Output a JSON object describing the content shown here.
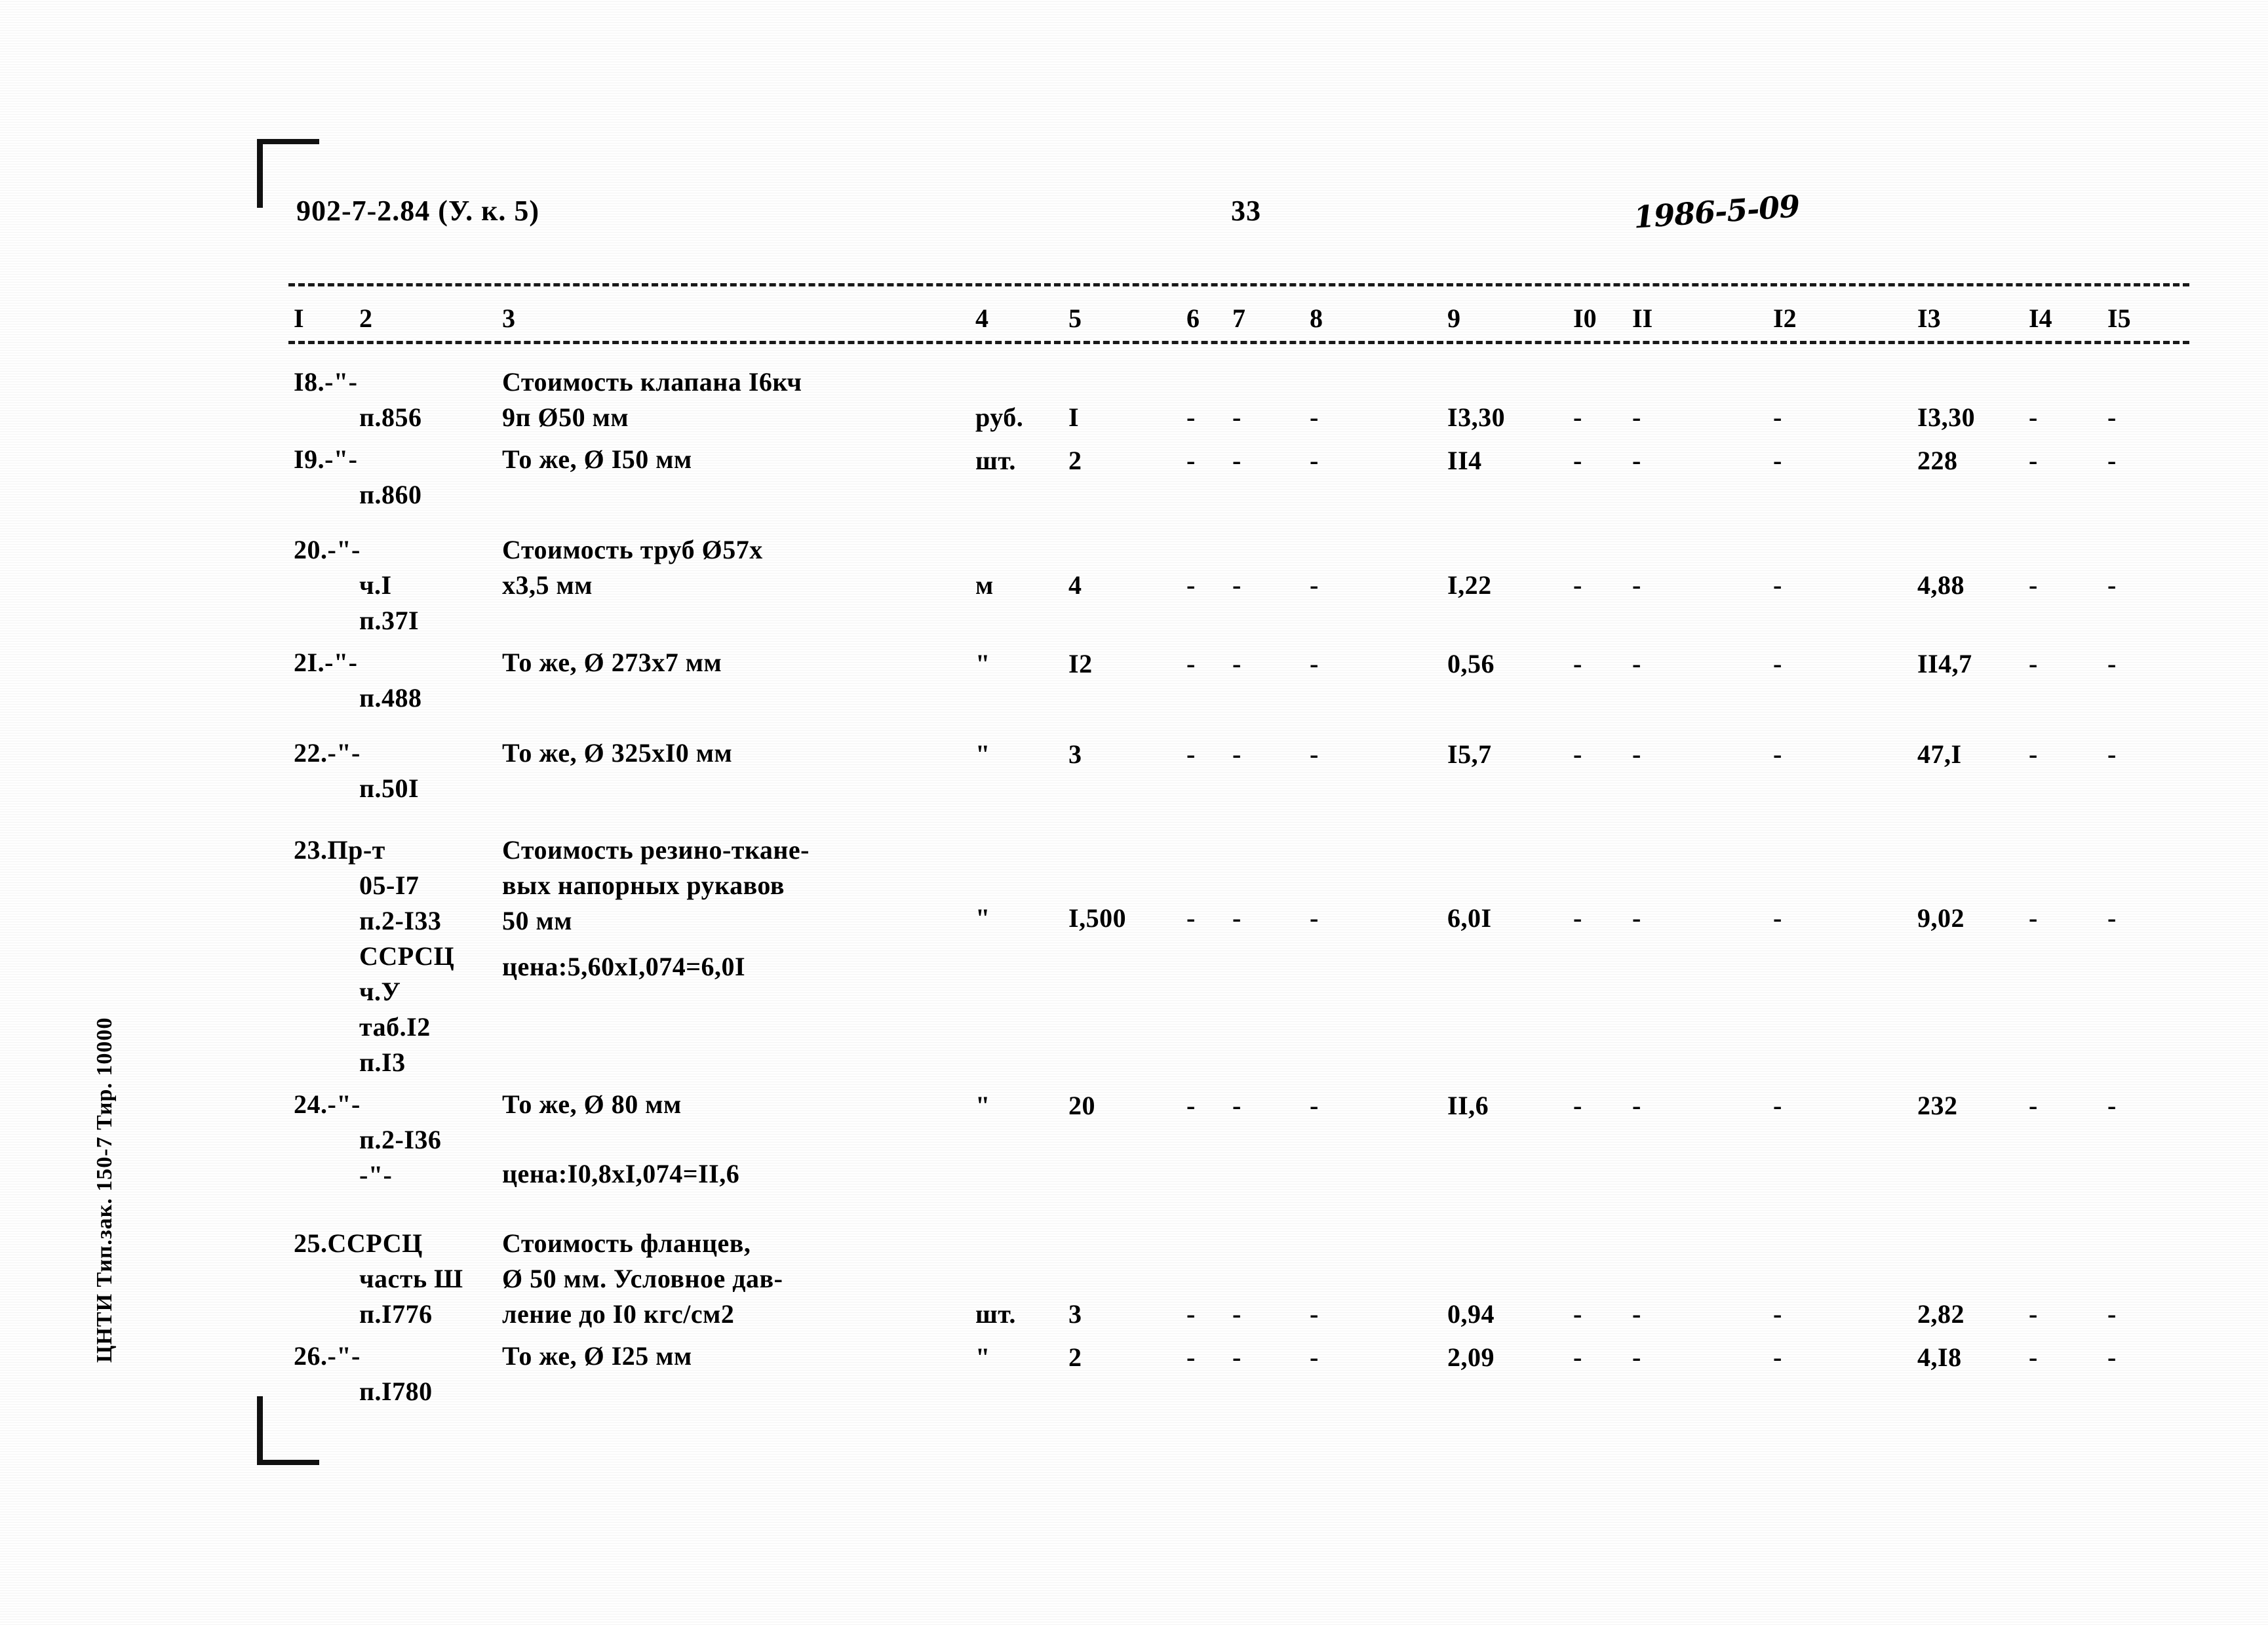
{
  "header": {
    "doc_code": "902-7-2.84 (У. к. 5)",
    "page_number": "33",
    "handwritten_note": "1986-5-09"
  },
  "imprint": {
    "sidebar_text": "ЦНТИ Тип.зак. 150-7 Тир. 10000"
  },
  "table": {
    "column_headers": [
      "I",
      "2",
      "3",
      "4",
      "5",
      "6",
      "7",
      "8",
      "9",
      "I0",
      "II",
      "I2",
      "I3",
      "I4",
      "I5"
    ],
    "dash": "-",
    "rows": [
      {
        "c1": "I8.-\"-",
        "c2": "п.856",
        "c3": "Стоимость клапана I6кч\n9п Ø50 мм",
        "c4": "руб.",
        "c5": "I",
        "c6": "-",
        "c7": "-",
        "c8": "-",
        "c9": "I3,30",
        "c10": "-",
        "c11": "-",
        "c12": "-",
        "c13": "I3,30",
        "c14": "-",
        "c15": "-"
      },
      {
        "c1": "I9.-\"-",
        "c2": "п.860",
        "c3": "То же, Ø I50 мм",
        "c4": "шт.",
        "c5": "2",
        "c6": "-",
        "c7": "-",
        "c8": "-",
        "c9": "II4",
        "c10": "-",
        "c11": "-",
        "c12": "-",
        "c13": "228",
        "c14": "-",
        "c15": "-"
      },
      {
        "c1": "20.-\"-",
        "c2": "ч.I\nп.37I",
        "c3": "Стоимость труб Ø57х\nх3,5 мм",
        "c4": "м",
        "c5": "4",
        "c6": "-",
        "c7": "-",
        "c8": "-",
        "c9": "I,22",
        "c10": "-",
        "c11": "-",
        "c12": "-",
        "c13": "4,88",
        "c14": "-",
        "c15": "-"
      },
      {
        "c1": "2I.-\"-",
        "c2": "п.488",
        "c3": "То же, Ø 273х7 мм",
        "c4": "\"",
        "c5": "I2",
        "c6": "-",
        "c7": "-",
        "c8": "-",
        "c9": "0,56",
        "c10": "-",
        "c11": "-",
        "c12": "-",
        "c13": "II4,7",
        "c14": "-",
        "c15": "-"
      },
      {
        "c1": "22.-\"-",
        "c2": "п.50I",
        "c3": "То же, Ø 325хI0 мм",
        "c4": "\"",
        "c5": "3",
        "c6": "-",
        "c7": "-",
        "c8": "-",
        "c9": "I5,7",
        "c10": "-",
        "c11": "-",
        "c12": "-",
        "c13": "47,I",
        "c14": "-",
        "c15": "-"
      },
      {
        "c1": "23.Пр-т",
        "c2": "05-I7\nп.2-I33\nССРСЦ\nч.У\nтаб.I2\nп.I3",
        "c3": "Стоимость резино-тканe-\nвых напорных рукавов\n50 мм",
        "c3b": "цена:5,60хI,074=6,0I",
        "c4": "\"",
        "c5": "I,500",
        "c6": "-",
        "c7": "-",
        "c8": "-",
        "c9": "6,0I",
        "c10": "-",
        "c11": "-",
        "c12": "-",
        "c13": "9,02",
        "c14": "-",
        "c15": "-"
      },
      {
        "c1": "24.-\"-",
        "c2": "п.2-I36\n-\"-",
        "c3": "То же, Ø 80 мм",
        "c3b": "цена:I0,8хI,074=II,6",
        "c4": "\"",
        "c5": "20",
        "c6": "-",
        "c7": "-",
        "c8": "-",
        "c9": "II,6",
        "c10": "-",
        "c11": "-",
        "c12": "-",
        "c13": "232",
        "c14": "-",
        "c15": "-"
      },
      {
        "c1": "25.ССРСЦ",
        "c2": "часть Ш\nп.I776",
        "c3": "Стоимость фланцев,\nØ 50 мм. Условное дав-\nление до I0 кгс/см2",
        "c4": "шт.",
        "c5": "3",
        "c6": "-",
        "c7": "-",
        "c8": "-",
        "c9": "0,94",
        "c10": "-",
        "c11": "-",
        "c12": "-",
        "c13": "2,82",
        "c14": "-",
        "c15": "-"
      },
      {
        "c1": "26.-\"-",
        "c2": "п.I780",
        "c3": "То же, Ø I25 мм",
        "c4": "\"",
        "c5": "2",
        "c6": "-",
        "c7": "-",
        "c8": "-",
        "c9": "2,09",
        "c10": "-",
        "c11": "-",
        "c12": "-",
        "c13": "4,I8",
        "c14": "-",
        "c15": "-"
      }
    ]
  }
}
